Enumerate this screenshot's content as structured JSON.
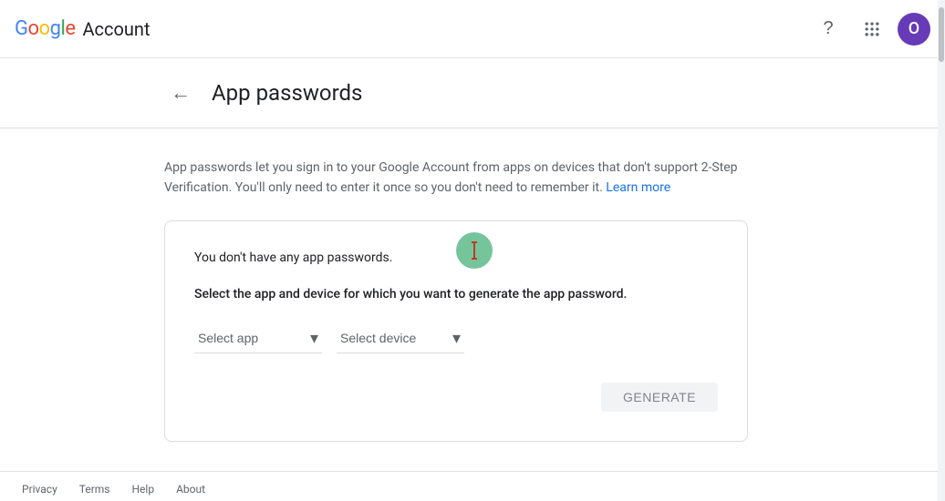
{
  "header": {
    "logo": {
      "google": "Google",
      "g_b": "G",
      "g_r": "o",
      "g_y": "o",
      "g_g": "g",
      "g_b2": "l",
      "g_r2": "e",
      "account_label": "Account"
    },
    "help_icon": "?",
    "apps_icon": "⠿",
    "avatar_letter": "O"
  },
  "page": {
    "back_arrow": "←",
    "title": "App passwords",
    "description": "App passwords let you sign in to your Google Account from apps on devices that don't support 2-Step Verification. You'll only need to enter it once so you don't need to remember it.",
    "learn_more_label": "Learn more"
  },
  "card": {
    "no_passwords_text": "You don't have any app passwords.",
    "instruction": "Select the app and device for which you want to generate the app password.",
    "select_app_label": "Select app",
    "select_device_label": "Select device",
    "generate_button_label": "GENERATE"
  },
  "footer": {
    "privacy": "Privacy",
    "terms": "Terms",
    "help": "Help",
    "about": "About"
  }
}
